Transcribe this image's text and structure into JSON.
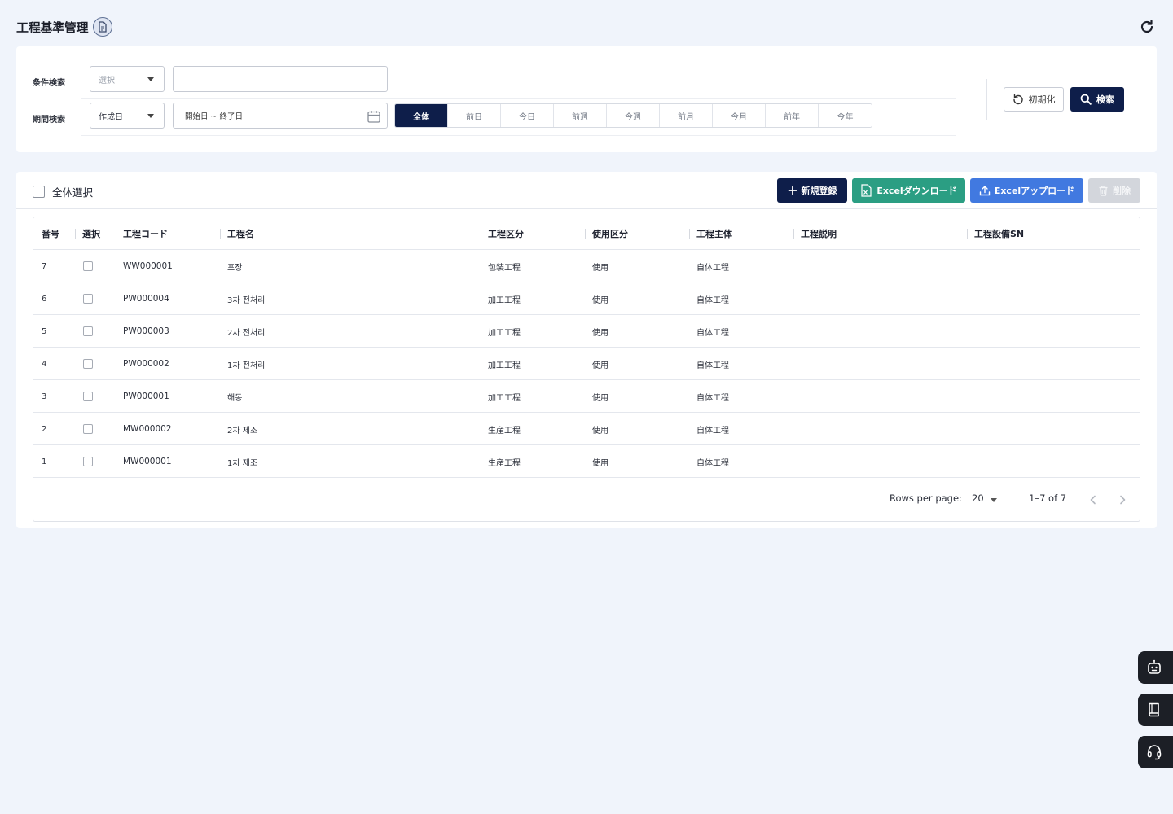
{
  "header": {
    "title": "工程基準管理"
  },
  "filter": {
    "condition_label": "条件検索",
    "condition_select": "選択",
    "period_label": "期間検索",
    "period_select": "作成日",
    "date_range": "開始日 ~ 終了日",
    "period_tabs": [
      "全体",
      "前日",
      "今日",
      "前週",
      "今週",
      "前月",
      "今月",
      "前年",
      "今年"
    ],
    "active_tab": "全体",
    "reset_label": "初期化",
    "search_label": "検索"
  },
  "toolbar": {
    "select_all_label": "全体選択",
    "new_label": "新規登録",
    "excel_download_label": "Excelダウンロード",
    "excel_upload_label": "Excelアップロード",
    "delete_label": "削除"
  },
  "table": {
    "columns": [
      "番号",
      "選択",
      "工程コード",
      "工程名",
      "工程区分",
      "使用区分",
      "工程主体",
      "工程説明",
      "工程設備SN"
    ],
    "rows": [
      {
        "no": "7",
        "code": "WW000001",
        "name": "포장",
        "category": "包装工程",
        "usage": "使用",
        "subject": "自体工程",
        "description": "",
        "equipment_sn": ""
      },
      {
        "no": "6",
        "code": "PW000004",
        "name": "3차 전처리",
        "category": "加工工程",
        "usage": "使用",
        "subject": "自体工程",
        "description": "",
        "equipment_sn": ""
      },
      {
        "no": "5",
        "code": "PW000003",
        "name": "2차 전처리",
        "category": "加工工程",
        "usage": "使用",
        "subject": "自体工程",
        "description": "",
        "equipment_sn": ""
      },
      {
        "no": "4",
        "code": "PW000002",
        "name": "1차 전처리",
        "category": "加工工程",
        "usage": "使用",
        "subject": "自体工程",
        "description": "",
        "equipment_sn": ""
      },
      {
        "no": "3",
        "code": "PW000001",
        "name": "해동",
        "category": "加工工程",
        "usage": "使用",
        "subject": "自体工程",
        "description": "",
        "equipment_sn": ""
      },
      {
        "no": "2",
        "code": "MW000002",
        "name": "2차 제조",
        "category": "生産工程",
        "usage": "使用",
        "subject": "自体工程",
        "description": "",
        "equipment_sn": ""
      },
      {
        "no": "1",
        "code": "MW000001",
        "name": "1차 제조",
        "category": "生産工程",
        "usage": "使用",
        "subject": "自体工程",
        "description": "",
        "equipment_sn": ""
      }
    ]
  },
  "pagination": {
    "rows_per_page_label": "Rows per page:",
    "rows_per_page": "20",
    "range_text": "1–7 of 7"
  },
  "floating_buttons": [
    "robot-icon",
    "book-icon",
    "headset-icon"
  ],
  "colors": {
    "navy": "#0e1e4a",
    "excel_green": "#2b9e83",
    "upload_blue": "#4179e0",
    "background": "#f0f4fb"
  }
}
